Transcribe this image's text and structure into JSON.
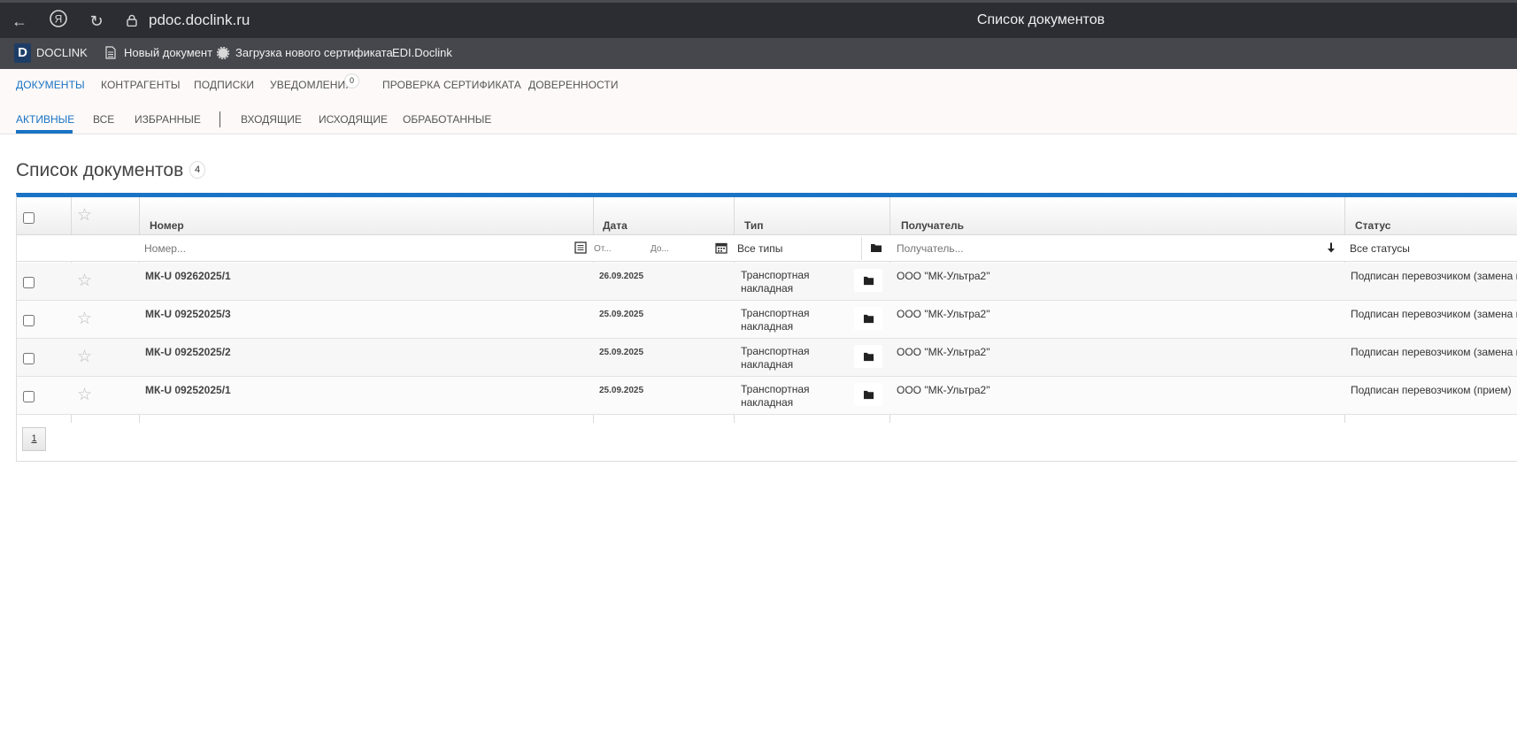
{
  "browser": {
    "url": "pdoc.doclink.ru",
    "title": "Список документов"
  },
  "bookmarks": {
    "logo_letter": "D",
    "items": [
      {
        "label": "DOCLINK",
        "icon": "doclink-logo"
      },
      {
        "label": "Новый документ",
        "icon": "document-icon"
      },
      {
        "label": "Загрузка нового сертификата",
        "icon": "gear-icon"
      },
      {
        "label": "EDI.Doclink",
        "icon": ""
      }
    ]
  },
  "topnav": {
    "items": [
      "ДОКУМЕНТЫ",
      "КОНТРАГЕНТЫ",
      "ПОДПИСКИ",
      "УВЕДОМЛЕНИЯ",
      "ПРОВЕРКА СЕРТИФИКАТА",
      "ДОВЕРЕННОСТИ"
    ],
    "active": "ДОКУМЕНТЫ",
    "notifications_count": "0"
  },
  "subnav": {
    "items": [
      "АКТИВНЫЕ",
      "ВСЕ",
      "ИЗБРАННЫЕ",
      "ВХОДЯЩИЕ",
      "ИСХОДЯЩИЕ",
      "ОБРАБОТАННЫЕ"
    ],
    "active": "АКТИВНЫЕ"
  },
  "heading": {
    "title": "Список документов",
    "count": "4"
  },
  "table": {
    "columns": {
      "number": "Номер",
      "date": "Дата",
      "type": "Тип",
      "recipient": "Получатель",
      "status": "Статус"
    },
    "filters": {
      "number_placeholder": "Номер...",
      "date_from_placeholder": "От...",
      "date_to_placeholder": "До...",
      "type_selected": "Все типы",
      "recipient_placeholder": "Получатель...",
      "status_selected": "Все статусы"
    },
    "rows": [
      {
        "number": "МК-U 09262025/1",
        "date": "26.09.2025",
        "type": "Транспортная накладная",
        "recipient": "ООО \"МК-Ультра2\"",
        "status": "Подписан перевозчиком (замена в"
      },
      {
        "number": "МК-U 09252025/3",
        "date": "25.09.2025",
        "type": "Транспортная накладная",
        "recipient": "ООО \"МК-Ультра2\"",
        "status": "Подписан перевозчиком (замена в"
      },
      {
        "number": "МК-U 09252025/2",
        "date": "25.09.2025",
        "type": "Транспортная накладная",
        "recipient": "ООО \"МК-Ультра2\"",
        "status": "Подписан перевозчиком (замена в"
      },
      {
        "number": "МК-U 09252025/1",
        "date": "25.09.2025",
        "type": "Транспортная накладная",
        "recipient": "ООО \"МК-Ультра2\"",
        "status": "Подписан перевозчиком (прием)"
      }
    ]
  },
  "pagination": {
    "current": "1"
  },
  "colors": {
    "accent": "#1a73c4",
    "browser_bar": "#2b2d33",
    "bookmarks_bar": "#45474d"
  }
}
